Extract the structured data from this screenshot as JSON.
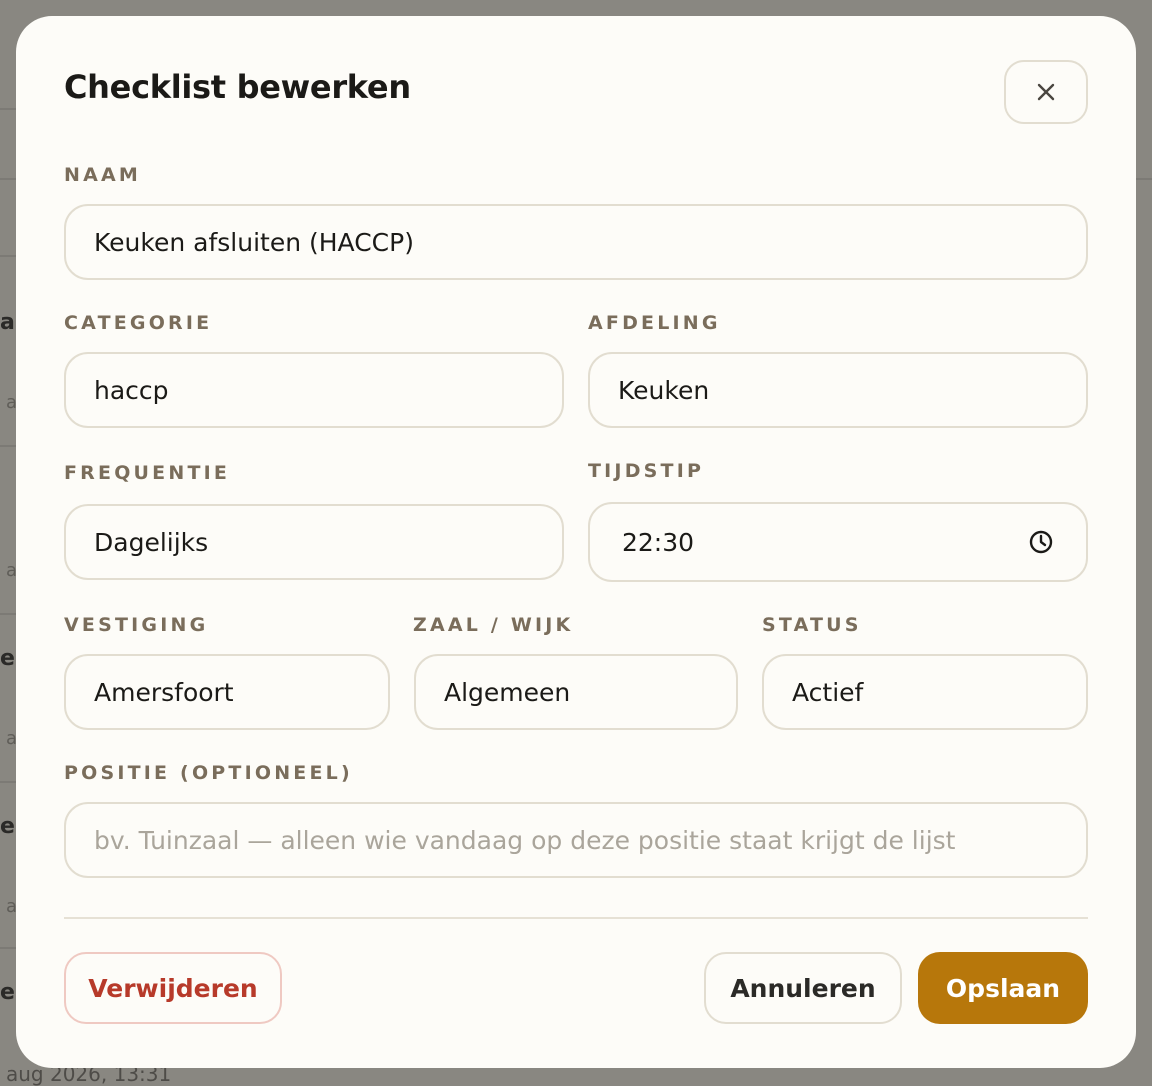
{
  "modal": {
    "title": "Checklist bewerken"
  },
  "fields": {
    "naam": {
      "label": "NAAM",
      "value": "Keuken afsluiten (HACCP)"
    },
    "categorie": {
      "label": "CATEGORIE",
      "value": "haccp"
    },
    "afdeling": {
      "label": "AFDELING",
      "value": "Keuken"
    },
    "frequentie": {
      "label": "FREQUENTIE",
      "value": "Dagelijks"
    },
    "tijdstip": {
      "label": "TIJDSTIP",
      "value": "22:30"
    },
    "vestiging": {
      "label": "VESTIGING",
      "value": "Amersfoort"
    },
    "zaal": {
      "label": "ZAAL / WIJK",
      "value": "Algemeen"
    },
    "status": {
      "label": "STATUS",
      "value": "Actief"
    },
    "positie": {
      "label": "POSITIE (OPTIONEEL)",
      "value": "",
      "placeholder": "bv. Tuinzaal — alleen wie vandaag op deze positie staat krijgt de lijst"
    }
  },
  "actions": {
    "delete_label": "Verwijderen",
    "cancel_label": "Annuleren",
    "save_label": "Opslaan"
  },
  "background": {
    "row_fragments": [
      "ar",
      "ei",
      "es",
      "er"
    ],
    "sub_fragments": [
      "a",
      "a",
      "a",
      "a"
    ],
    "bottom_text": "aug 2026, 13:31"
  },
  "colors": {
    "accent": "#b7770b",
    "danger": "#b73a2a",
    "label": "#7a6d5b",
    "border": "#e2ddd0",
    "surface": "#fdfcf8"
  },
  "icons": {
    "close": "close-icon",
    "clock": "clock-icon"
  }
}
